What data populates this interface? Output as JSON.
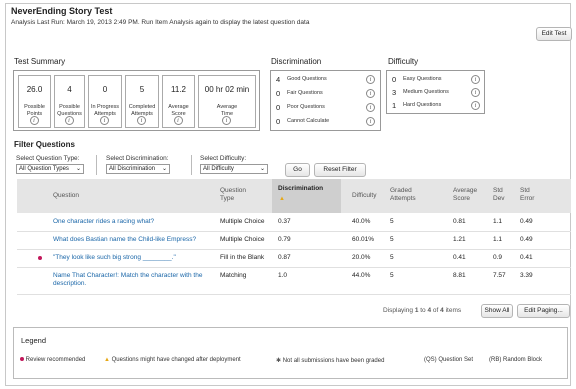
{
  "header": {
    "title": "NeverEnding Story Test",
    "subtitle": "Analysis Last Run: March 19, 2013 2:49 PM. Run Item Analysis again to display the latest question data",
    "edit_button": "Edit Test"
  },
  "test_summary": {
    "heading": "Test Summary",
    "cells": [
      {
        "value": "26.0",
        "label": "Possible Points"
      },
      {
        "value": "4",
        "label": "Possible Questions"
      },
      {
        "value": "0",
        "label": "In Progress Attempts"
      },
      {
        "value": "5",
        "label": "Completed Attempts"
      },
      {
        "value": "11.2",
        "label": "Average Score"
      },
      {
        "value": "00 hr 02 min",
        "label": "Average Time"
      }
    ]
  },
  "discrimination": {
    "heading": "Discrimination",
    "rows": [
      {
        "count": "4",
        "label": "Good Questions"
      },
      {
        "count": "0",
        "label": "Fair Questions"
      },
      {
        "count": "0",
        "label": "Poor Questions"
      },
      {
        "count": "0",
        "label": "Cannot Calculate"
      }
    ]
  },
  "difficulty": {
    "heading": "Difficulty",
    "rows": [
      {
        "count": "0",
        "label": "Easy Questions"
      },
      {
        "count": "3",
        "label": "Medium Questions"
      },
      {
        "count": "1",
        "label": "Hard Questions"
      }
    ]
  },
  "filter": {
    "heading": "Filter Questions",
    "type_label": "Select Question Type:",
    "type_value": "All Question Types",
    "disc_label": "Select Discrimination:",
    "disc_value": "All Discrimination",
    "diff_label": "Select Difficulty:",
    "diff_value": "All Difficulty",
    "go_button": "Go",
    "reset_button": "Reset Filter"
  },
  "table": {
    "headers": {
      "question": "Question",
      "type": "Question Type",
      "discrimination": "Discrimination",
      "difficulty": "Difficulty",
      "graded": "Graded Attempts",
      "avg": "Average Score",
      "std_dev": "Std Dev",
      "std_err": "Std Error"
    },
    "rows": [
      {
        "question": "One character rides a racing what?",
        "type": "Multiple Choice",
        "discrimination": "0.37",
        "difficulty": "40.0%",
        "graded": "5",
        "avg": "0.81",
        "std_dev": "1.1",
        "std_err": "0.49",
        "flag": false
      },
      {
        "question": "What does Bastian name the Child-like Empress?",
        "type": "Multiple Choice",
        "discrimination": "0.79",
        "difficulty": "60.01%",
        "graded": "5",
        "avg": "1.21",
        "std_dev": "1.1",
        "std_err": "0.49",
        "flag": false
      },
      {
        "question": "\"They look like such big strong ________.\"",
        "type": "Fill in the Blank",
        "discrimination": "0.87",
        "difficulty": "20.0%",
        "graded": "5",
        "avg": "0.41",
        "std_dev": "0.9",
        "std_err": "0.41",
        "flag": true
      },
      {
        "question": "Name That Character!: Match the character with the description.",
        "type": "Matching",
        "discrimination": "1.0",
        "difficulty": "44.0%",
        "graded": "5",
        "avg": "8.81",
        "std_dev": "7.57",
        "std_err": "3.39",
        "flag": false
      }
    ]
  },
  "pagination": {
    "prefix": "Displaying",
    "from": "1",
    "to_word": "to",
    "to": "4",
    "of_word": "of",
    "total": "4",
    "suffix": "items",
    "show_all": "Show All",
    "edit_paging": "Edit Paging..."
  },
  "legend": {
    "heading": "Legend",
    "review": "Review recommended",
    "changed": "Questions might have changed after deployment",
    "not_graded": "Not all submissions have been graded",
    "qs": "(QS) Question Set",
    "rb": "(RB) Random Block"
  },
  "colors": {
    "link": "#1a66a8",
    "flag_dot": "#c2185b",
    "warning": "#e6a817"
  },
  "icons": {
    "info": "i",
    "sort_asc": "▲",
    "caret": "⌄",
    "star": "✱"
  }
}
